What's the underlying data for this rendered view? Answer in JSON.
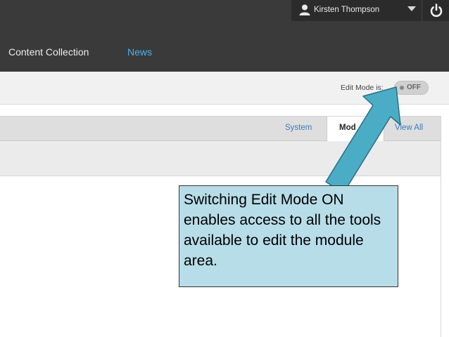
{
  "header": {
    "user_name": "Kirsten Thompson",
    "nav": {
      "content_collection": "Content Collection",
      "news": "News"
    }
  },
  "edit_mode": {
    "label": "Edit Mode is:",
    "state": "OFF"
  },
  "tabs": {
    "system": "System",
    "module": "Mod",
    "view_all": "View All"
  },
  "callout": {
    "text": "Switching Edit Mode ON enables access to all the tools available to edit the module area."
  },
  "colors": {
    "topbar": "#3a3a3a",
    "nav_active": "#4fb0e8",
    "callout_bg": "#b7dde8",
    "arrow_fill": "#4bacc6"
  },
  "icons": {
    "user": "user-icon",
    "caret": "chevron-down-icon",
    "power": "power-icon"
  }
}
